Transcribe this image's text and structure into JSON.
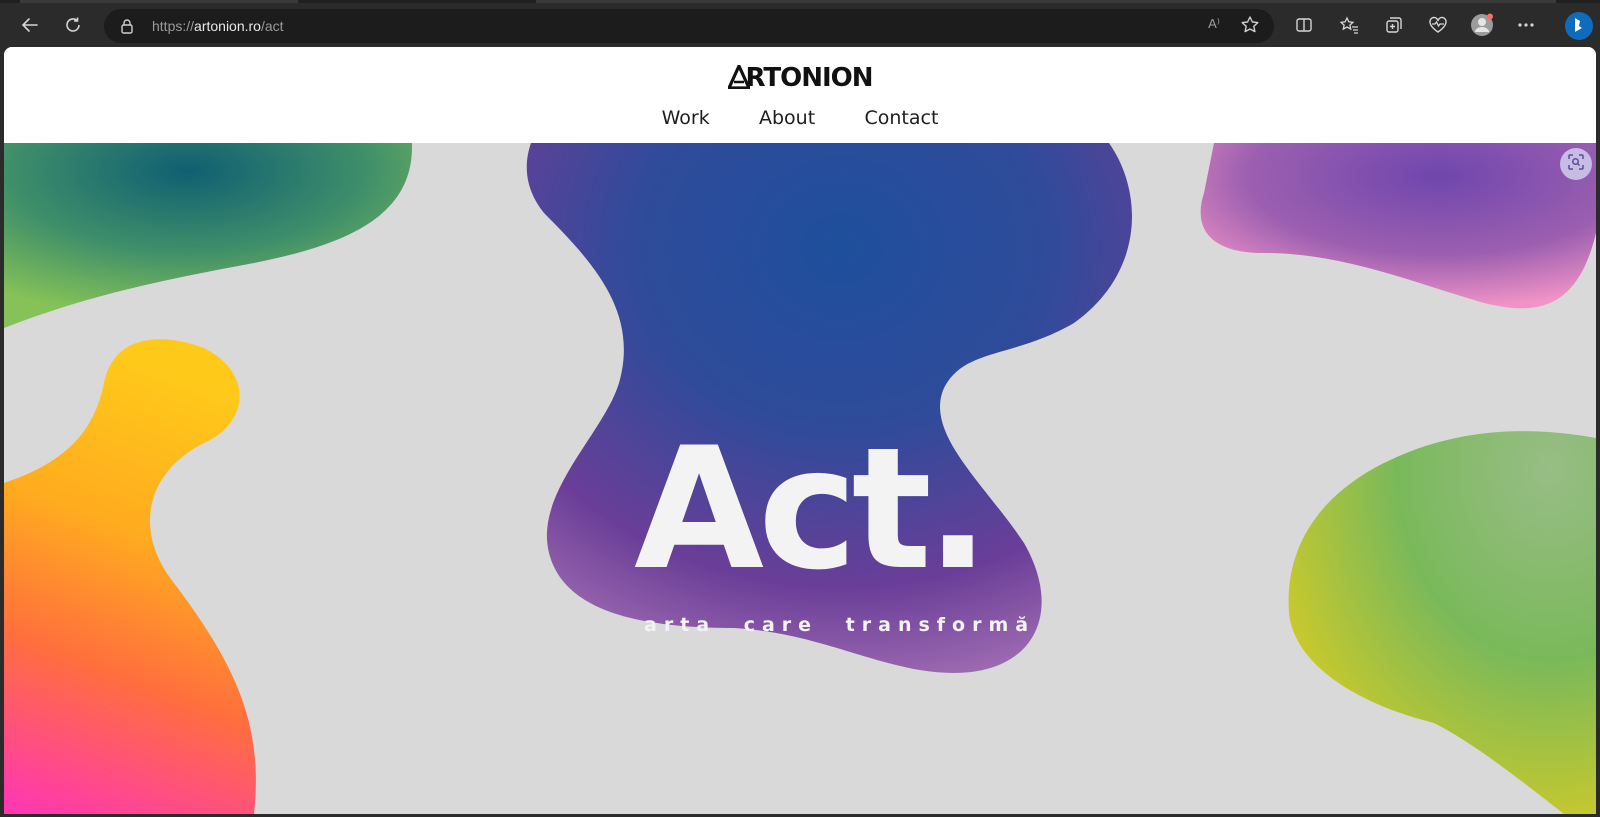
{
  "browser": {
    "url_scheme": "https://",
    "url_host": "artonion.ro",
    "url_path": "/act",
    "readaloud_label": "A⁾"
  },
  "site": {
    "logo_text": "RTONION",
    "nav": [
      "Work",
      "About",
      "Contact"
    ]
  },
  "hero": {
    "headline": "Act.",
    "tagline": "arta care transformă"
  },
  "colors": {
    "hero_bg": "#d9d9d9",
    "blob_center": [
      "#1f4e9a",
      "#6e3f98",
      "#b07ab8"
    ],
    "blob_topleft": [
      "#0f5f73",
      "#7cbf55"
    ],
    "blob_left": [
      "#ffc61a",
      "#ff7a2e",
      "#ff3fa8"
    ],
    "blob_topright": [
      "#7a4bb0",
      "#f08ec5"
    ],
    "blob_right": [
      "#7fbf5e",
      "#d2cc2a"
    ]
  }
}
